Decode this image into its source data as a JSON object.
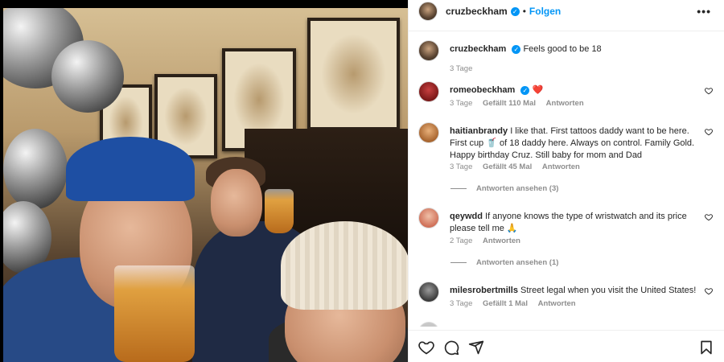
{
  "post": {
    "author": "cruzbeckham",
    "follow_label": "Folgen",
    "separator": "•",
    "more_label": "•••",
    "caption": {
      "username": "cruzbeckham",
      "text": "Feels good to be 18",
      "time": "3 Tage"
    }
  },
  "comments": [
    {
      "username": "romeobeckham",
      "text": "❤️",
      "time": "3 Tage",
      "likes": "Gefällt 110 Mal",
      "reply": "Antworten",
      "verified": true
    },
    {
      "username": "haitianbrandy",
      "text": "I like that. First tattoos daddy want to be here. First cup 🥤 of 18 daddy here. Always on control. Family Gold. Happy birthday Cruz. Still baby for mom and Dad",
      "time": "3 Tage",
      "likes": "Gefällt 45 Mal",
      "reply": "Antworten",
      "view_replies": "Antworten ansehen (3)"
    },
    {
      "username": "qeywdd",
      "text": "If anyone knows the type of wristwatch and its price please tell me 🙏",
      "time": "2 Tage",
      "reply": "Antworten",
      "view_replies": "Antworten ansehen (1)"
    },
    {
      "username": "milesrobertmills",
      "text": "Street legal when you visit the United States!",
      "time": "3 Tage",
      "likes": "Gefällt 1 Mal",
      "reply": "Antworten"
    }
  ],
  "icons": {
    "like": "heart-icon",
    "comment": "comment-icon",
    "share": "share-icon",
    "save": "bookmark-icon",
    "verified": "verified-badge-icon",
    "more": "more-options-icon"
  },
  "colors": {
    "accent": "#0095f6",
    "heart": "#ed4956",
    "muted": "#8e8e8e",
    "text": "#262626"
  }
}
